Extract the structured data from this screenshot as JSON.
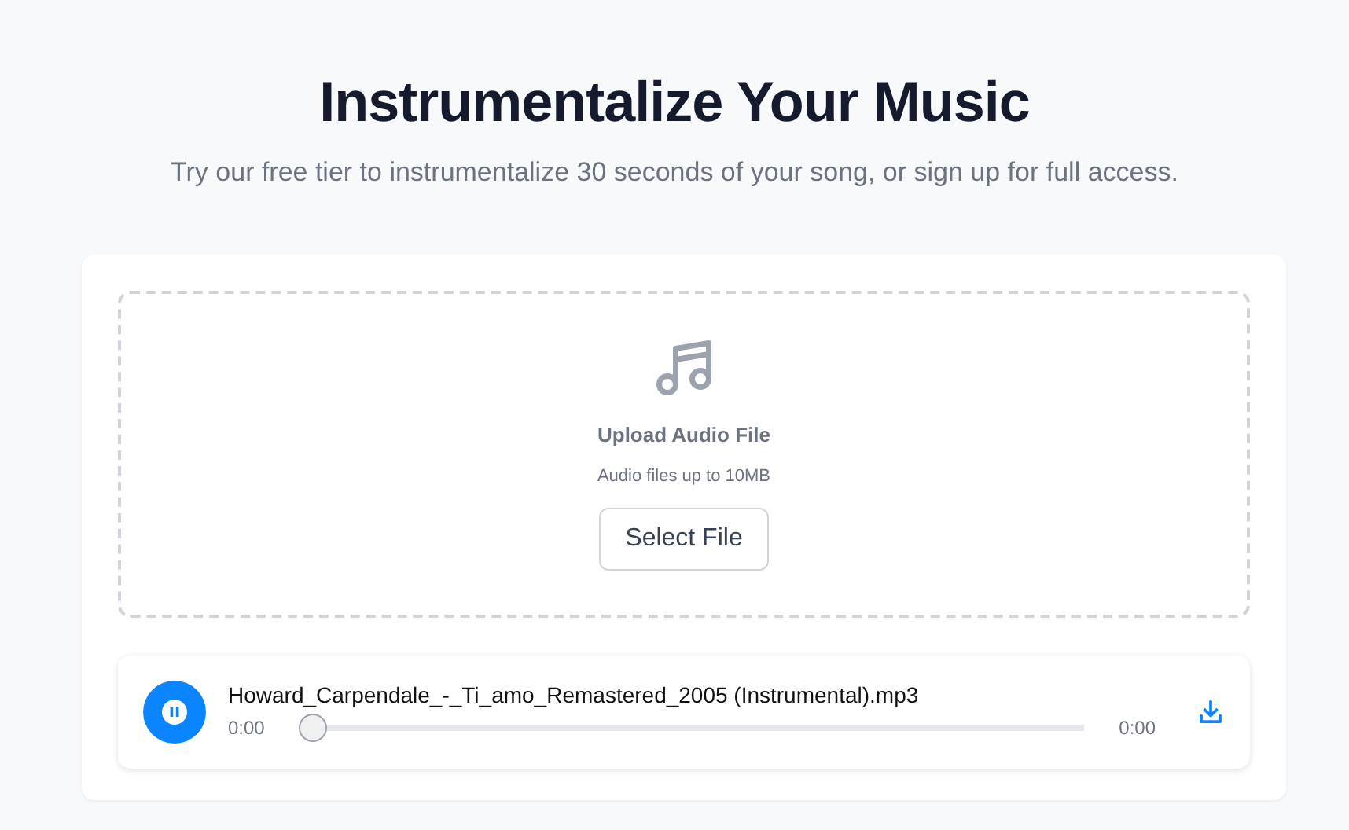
{
  "header": {
    "title": "Instrumentalize Your Music",
    "subtitle": "Try our free tier to instrumentalize 30 seconds of your song, or sign up for full access."
  },
  "upload": {
    "title": "Upload Audio File",
    "hint": "Audio files up to 10MB",
    "button": "Select File"
  },
  "player": {
    "filename": "Howard_Carpendale_-_Ti_amo_Remastered_2005 (Instrumental).mp3",
    "playing": true,
    "current_time": "0:00",
    "duration": "0:00",
    "level": 0
  }
}
